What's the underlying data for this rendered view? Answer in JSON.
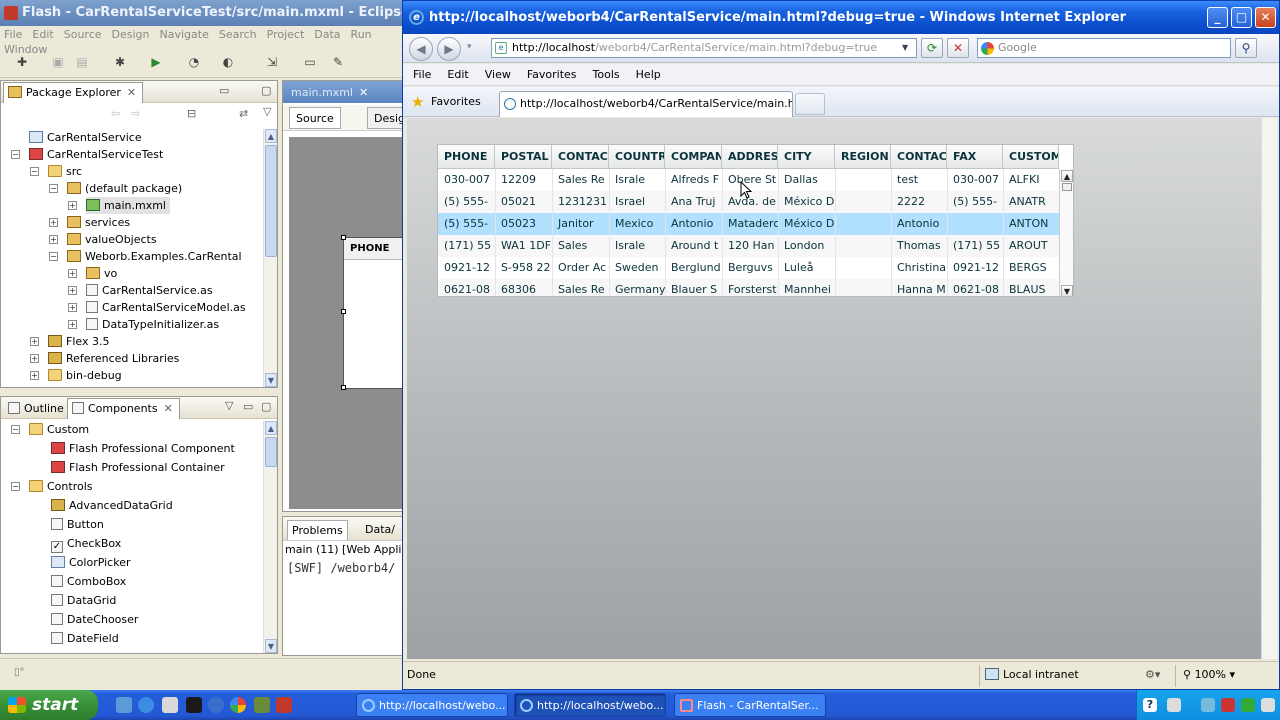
{
  "eclipse": {
    "title": "Flash - CarRentalServiceTest/src/main.mxml - Eclipse Platform",
    "menu": [
      "File",
      "Edit",
      "Source",
      "Design",
      "Navigate",
      "Search",
      "Project",
      "Data",
      "Run",
      "Window"
    ],
    "package_explorer": {
      "tab_label": "Package Explorer",
      "items": [
        {
          "label": "CarRentalService",
          "icon": "project-icon"
        },
        {
          "label": "CarRentalServiceTest",
          "icon": "flex-project-icon"
        },
        {
          "label": "src",
          "icon": "source-folder-icon"
        },
        {
          "label": "(default package)",
          "icon": "package-icon"
        },
        {
          "label": "main.mxml",
          "icon": "mxml-file-icon"
        },
        {
          "label": "services",
          "icon": "package-icon"
        },
        {
          "label": "valueObjects",
          "icon": "package-icon"
        },
        {
          "label": "Weborb.Examples.CarRental",
          "icon": "package-icon"
        },
        {
          "label": "vo",
          "icon": "package-icon"
        },
        {
          "label": "CarRentalService.as",
          "icon": "as-file-icon"
        },
        {
          "label": "CarRentalServiceModel.as",
          "icon": "as-file-icon"
        },
        {
          "label": "DataTypeInitializer.as",
          "icon": "as-file-icon"
        },
        {
          "label": "Flex 3.5",
          "icon": "library-icon"
        },
        {
          "label": "Referenced Libraries",
          "icon": "library-icon"
        },
        {
          "label": "bin-debug",
          "icon": "folder-icon"
        }
      ]
    },
    "components_view": {
      "tab_outline": "Outline",
      "tab_components": "Components",
      "items": [
        {
          "label": "Custom",
          "icon": "folder-icon"
        },
        {
          "label": "Flash Professional Component",
          "icon": "flash-component-icon"
        },
        {
          "label": "Flash Professional Container",
          "icon": "flash-container-icon"
        },
        {
          "label": "Controls",
          "icon": "folder-icon"
        },
        {
          "label": "AdvancedDataGrid",
          "icon": "advanced-datagrid-icon"
        },
        {
          "label": "Button",
          "icon": "button-control-icon"
        },
        {
          "label": "CheckBox",
          "icon": "checkbox-control-icon"
        },
        {
          "label": "ColorPicker",
          "icon": "colorpicker-control-icon"
        },
        {
          "label": "ComboBox",
          "icon": "combobox-control-icon"
        },
        {
          "label": "DataGrid",
          "icon": "datagrid-control-icon"
        },
        {
          "label": "DateChooser",
          "icon": "datechooser-control-icon"
        },
        {
          "label": "DateField",
          "icon": "datefield-control-icon"
        }
      ]
    },
    "editor": {
      "tab_label": "main.mxml",
      "source_tab": "Source",
      "design_tab": "Desig",
      "design_header": "PHONE"
    },
    "problems": {
      "tab_problems": "Problems",
      "tab_data": "Data/",
      "line1": "main (11) [Web Applicati",
      "line2": "[SWF] /weborb4/"
    }
  },
  "ie": {
    "title": "http://localhost/weborb4/CarRentalService/main.html?debug=true - Windows Internet Explorer",
    "address_host": "http://localhost",
    "address_rest": "/weborb4/CarRentalService/main.html?debug=true",
    "search_placeholder": "Google",
    "menu": [
      "File",
      "Edit",
      "View",
      "Favorites",
      "Tools",
      "Help"
    ],
    "favorites_label": "Favorites",
    "tab_label": "http://localhost/weborb4/CarRentalService/main.html...",
    "status": "Done",
    "zone": "Local intranet",
    "zoom": "100%",
    "datagrid": {
      "headers": [
        "PHONE",
        "POSTAL",
        "CONTAC",
        "COUNTR",
        "COMPAN",
        "ADDRES",
        "CITY",
        "REGION",
        "CONTAC",
        "FAX",
        "CUSTOM"
      ],
      "rows": [
        [
          "030-007",
          "12209",
          "Sales Re",
          "Israle",
          "Alfreds F",
          "Obere St",
          "Dallas",
          "",
          "test",
          "030-007",
          "ALFKI"
        ],
        [
          "(5) 555-",
          "05021",
          "1231231",
          "Israel",
          "Ana Truj",
          "Avda. de",
          "México D",
          "",
          "2222",
          "(5) 555-",
          "ANATR"
        ],
        [
          "(5) 555-",
          "05023",
          "Janitor",
          "Mexico",
          "Antonio",
          "Matadero",
          "México D",
          "",
          "Antonio",
          "",
          "ANTON"
        ],
        [
          "(171) 55",
          "WA1 1DF",
          "Sales",
          "Israle",
          "Around t",
          "120 Han",
          "London",
          "",
          "Thomas",
          "(171) 55",
          "AROUT"
        ],
        [
          "0921-12",
          "S-958 22",
          "Order Ac",
          "Sweden",
          "Berglund",
          "Berguvs",
          "Luleå",
          "",
          "Christina",
          "0921-12",
          "BERGS"
        ],
        [
          "0621-08",
          "68306",
          "Sales Re",
          "Germany",
          "Blauer S",
          "Forsterst",
          "Mannhei",
          "",
          "Hanna M",
          "0621-08",
          "BLAUS"
        ]
      ],
      "selected_row": 2
    }
  },
  "taskbar": {
    "start_label": "start",
    "tasks": [
      {
        "label": "http://localhost/webo..."
      },
      {
        "label": "http://localhost/webo..."
      },
      {
        "label": "Flash - CarRentalSer..."
      }
    ]
  }
}
